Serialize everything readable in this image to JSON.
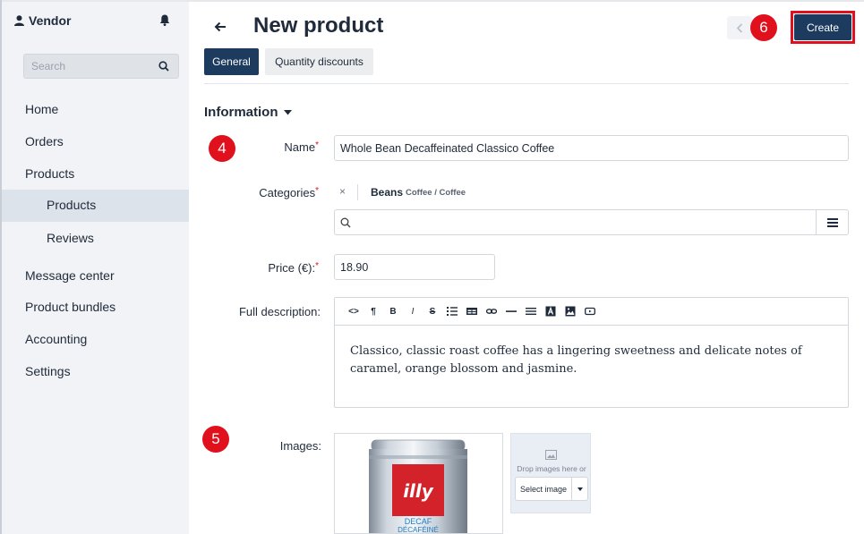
{
  "sidebar": {
    "vendor_label": "Vendor",
    "search_placeholder": "Search",
    "items": [
      {
        "label": "Home"
      },
      {
        "label": "Orders"
      },
      {
        "label": "Products"
      },
      {
        "label": "Products"
      },
      {
        "label": "Reviews"
      },
      {
        "label": "Message center"
      },
      {
        "label": "Product bundles"
      },
      {
        "label": "Accounting"
      },
      {
        "label": "Settings"
      }
    ]
  },
  "header": {
    "title": "New product",
    "create_label": "Create"
  },
  "badges": {
    "b4": "4",
    "b5": "5",
    "b6": "6"
  },
  "tabs": [
    {
      "label": "General",
      "active": true
    },
    {
      "label": "Quantity discounts",
      "active": false
    }
  ],
  "section": {
    "title": "Information"
  },
  "form": {
    "name_label": "Name",
    "name_value": "Whole Bean Decaffeinated Classico Coffee",
    "categories_label": "Categories",
    "category_remove": "×",
    "category_name": "Beans",
    "category_path": "Coffee / Coffee",
    "price_label": "Price (€):",
    "price_value": "18.90",
    "description_label": "Full description:",
    "description_text": "Classico, classic roast coffee has a lingering sweetness and delicate notes of caramel, orange blossom and jasmine.",
    "images_label": "Images:",
    "drop_text": "Drop images here or",
    "select_image_label": "Select image",
    "required_mark": "*"
  },
  "product_image": {
    "brand": "illy",
    "line1": "DECAF",
    "line2": "DÉCAFÉINÉ"
  },
  "colors": {
    "primary": "#1d3b5f",
    "annotation_red": "#e0101c",
    "sidebar_bg": "#f1f3f6"
  }
}
